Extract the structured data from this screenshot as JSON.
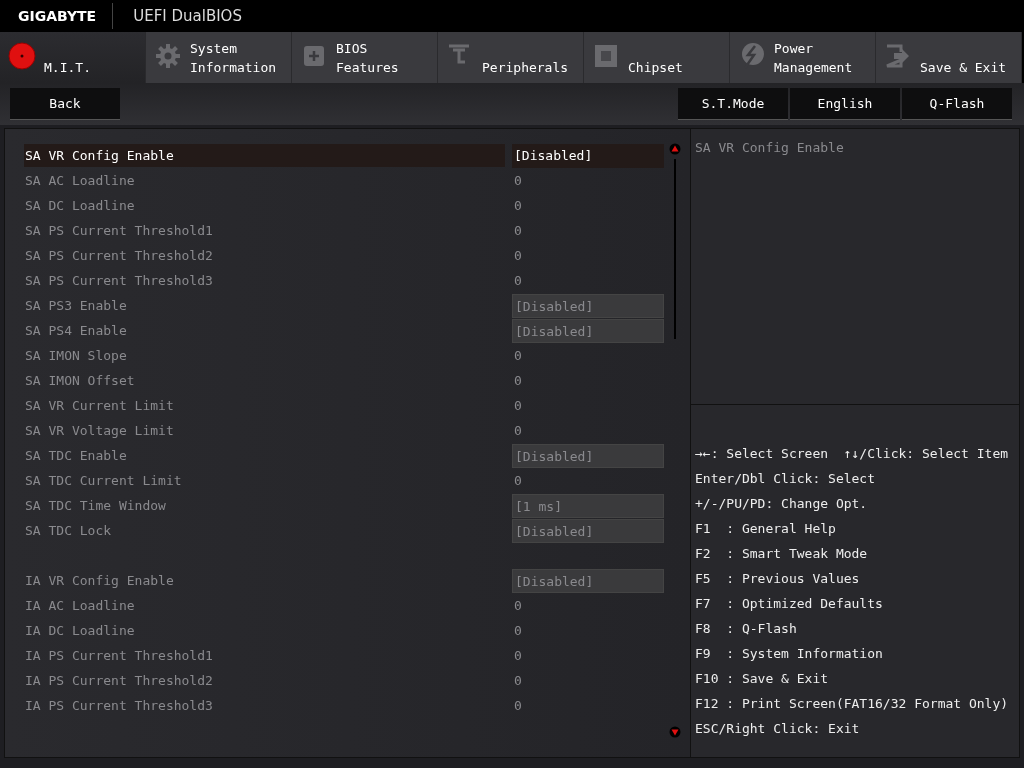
{
  "header": {
    "brand": "GIGABYTE",
    "title": "UEFI DualBIOS"
  },
  "tabs": [
    {
      "label": [
        "M.I.T."
      ],
      "selected": true
    },
    {
      "label": [
        "System",
        "Information"
      ],
      "selected": false
    },
    {
      "label": [
        "BIOS",
        "Features"
      ],
      "selected": false
    },
    {
      "label": [
        "Peripherals"
      ],
      "selected": false
    },
    {
      "label": [
        "Chipset"
      ],
      "selected": false
    },
    {
      "label": [
        "Power",
        "Management"
      ],
      "selected": false
    },
    {
      "label": [
        "Save & Exit"
      ],
      "selected": false
    }
  ],
  "toolbar": {
    "back": "Back",
    "buttons": [
      "S.T.Mode",
      "English",
      "Q-Flash"
    ]
  },
  "sections": [
    {
      "items": [
        {
          "label": "SA VR Config Enable",
          "value": "[Disabled]",
          "kind": "option",
          "selected": true
        },
        {
          "label": "SA AC Loadline",
          "value": "0",
          "kind": "number",
          "selected": false
        },
        {
          "label": "SA DC Loadline",
          "value": "0",
          "kind": "number",
          "selected": false
        },
        {
          "label": "SA PS Current Threshold1",
          "value": "0",
          "kind": "number",
          "selected": false
        },
        {
          "label": "SA PS Current Threshold2",
          "value": "0",
          "kind": "number",
          "selected": false
        },
        {
          "label": "SA PS Current Threshold3",
          "value": "0",
          "kind": "number",
          "selected": false
        },
        {
          "label": "SA PS3 Enable",
          "value": "[Disabled]",
          "kind": "option",
          "selected": false
        },
        {
          "label": "SA PS4 Enable",
          "value": "[Disabled]",
          "kind": "option",
          "selected": false
        },
        {
          "label": "SA IMON Slope",
          "value": "0",
          "kind": "number",
          "selected": false
        },
        {
          "label": "SA IMON Offset",
          "value": "0",
          "kind": "number",
          "selected": false
        },
        {
          "label": "SA VR Current Limit",
          "value": "0",
          "kind": "number",
          "selected": false
        },
        {
          "label": "SA VR Voltage Limit",
          "value": "0",
          "kind": "number",
          "selected": false
        },
        {
          "label": "SA TDC Enable",
          "value": "[Disabled]",
          "kind": "option",
          "selected": false
        },
        {
          "label": "SA TDC Current Limit",
          "value": "0",
          "kind": "number",
          "selected": false
        },
        {
          "label": "SA TDC Time Window",
          "value": "[1 ms]",
          "kind": "option",
          "selected": false
        },
        {
          "label": "SA TDC Lock",
          "value": "[Disabled]",
          "kind": "option",
          "selected": false
        }
      ]
    },
    {
      "items": [
        {
          "label": "IA VR Config Enable",
          "value": "[Disabled]",
          "kind": "option",
          "selected": false
        },
        {
          "label": "IA AC Loadline",
          "value": "0",
          "kind": "number",
          "selected": false
        },
        {
          "label": "IA DC Loadline",
          "value": "0",
          "kind": "number",
          "selected": false
        },
        {
          "label": "IA PS Current Threshold1",
          "value": "0",
          "kind": "number",
          "selected": false
        },
        {
          "label": "IA PS Current Threshold2",
          "value": "0",
          "kind": "number",
          "selected": false
        },
        {
          "label": "IA PS Current Threshold3",
          "value": "0",
          "kind": "number",
          "selected": false
        }
      ]
    }
  ],
  "description": "SA VR Config Enable",
  "help": [
    "→←: Select Screen  ↑↓/Click: Select Item",
    "Enter/Dbl Click: Select",
    "+/-/PU/PD: Change Opt.",
    "F1  : General Help",
    "F2  : Smart Tweak Mode",
    "F5  : Previous Values",
    "F7  : Optimized Defaults",
    "F8  : Q-Flash",
    "F9  : System Information",
    "F10 : Save & Exit",
    "F12 : Print Screen(FAT16/32 Format Only)",
    "ESC/Right Click: Exit"
  ]
}
